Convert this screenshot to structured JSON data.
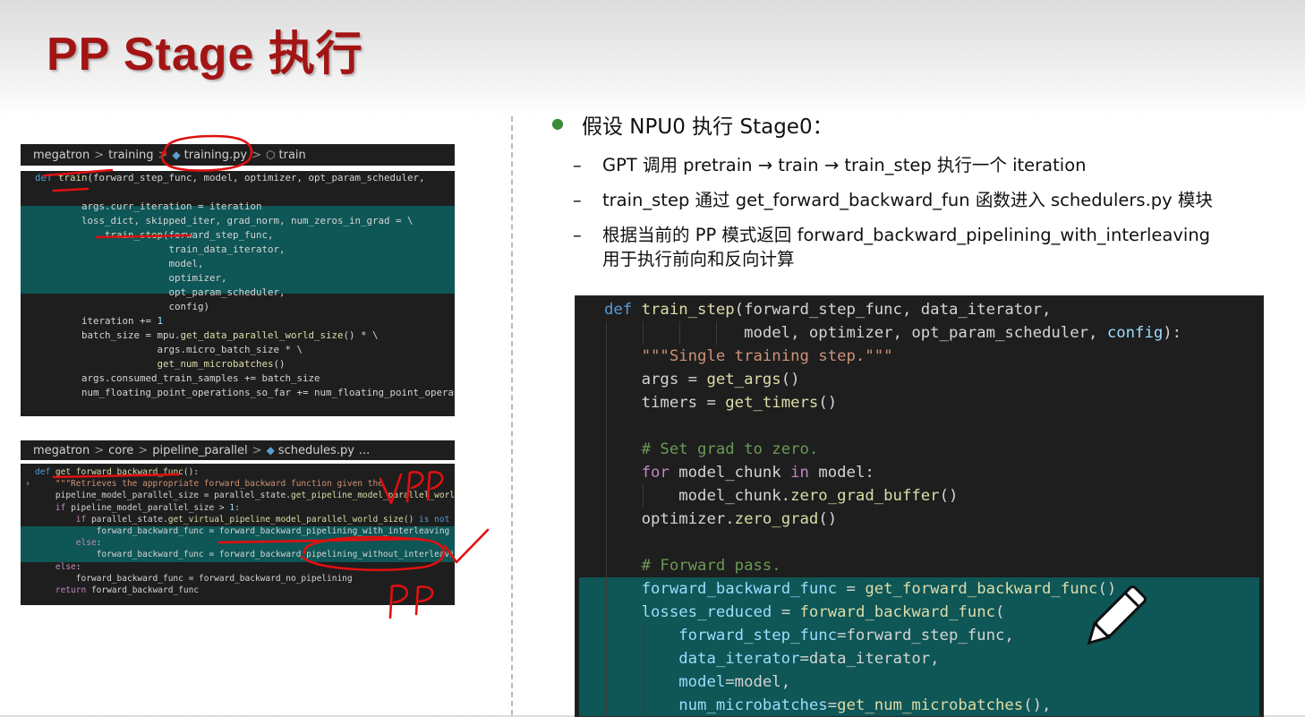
{
  "slide": {
    "title": "PP Stage 执行"
  },
  "left": {
    "breadcrumb1": {
      "seg1": "megatron",
      "seg2": "training",
      "seg3": "training.py",
      "seg4": "train",
      "sep": ">"
    },
    "breadcrumb2": {
      "seg1": "megatron",
      "seg2": "core",
      "seg3": "pipeline_parallel",
      "seg4": "schedules.py",
      "seg5": "...",
      "sep": ">"
    }
  },
  "right": {
    "bullet_main": "假设 NPU0 执行 Stage0：",
    "sub_dash": "–",
    "sub1": "GPT 调用 pretrain → train → train_step 执行一个 iteration",
    "sub2": "train_step 通过 get_forward_backward_fun 函数进入 schedulers.py 模块",
    "sub3_line1": "根据当前的 PP 模式返回 forward_backward_pipelining_with_interleaving",
    "sub3_line2": "用于执行前向和反向计算"
  },
  "annotations": {
    "vpp": "VPP",
    "pp": "PP"
  },
  "icons": {
    "file": "python-file-icon",
    "symbol": "cube-icon",
    "pen": "pencil-icon",
    "fold": "chevron-right-icon"
  },
  "colors": {
    "title": "#a31515",
    "highlight": "#0f5656",
    "ink": "#e01010",
    "bullet": "#3a8a3a"
  }
}
